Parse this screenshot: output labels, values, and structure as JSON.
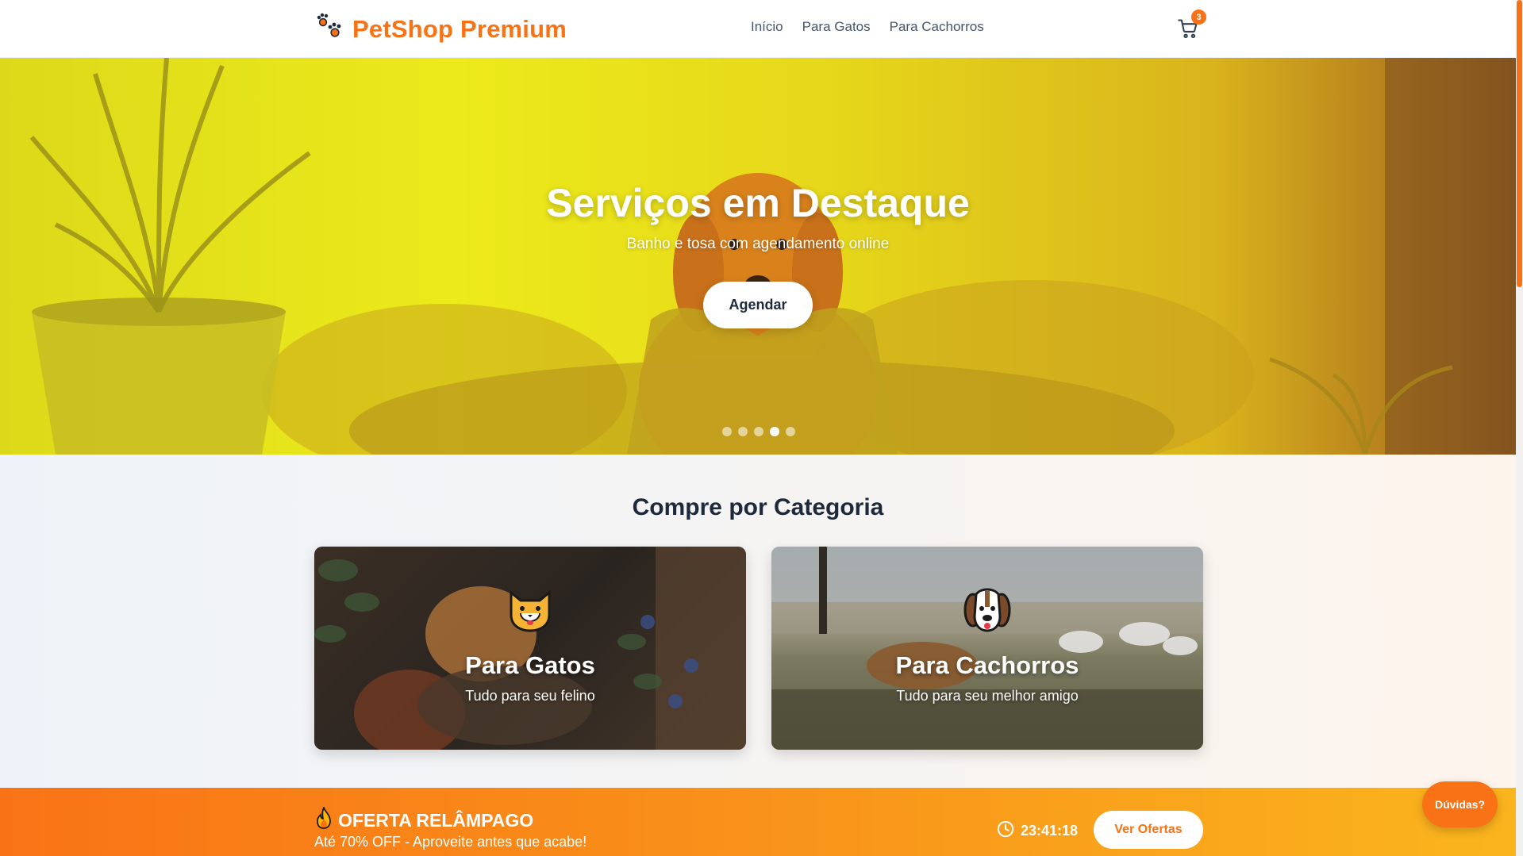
{
  "header": {
    "logo_icon": "paw-prints-icon",
    "brand": "PetShop Premium",
    "nav": [
      {
        "label": "Início"
      },
      {
        "label": "Para Gatos"
      },
      {
        "label": "Para Cachorros"
      }
    ],
    "cart_icon": "cart-icon",
    "cart_count": "3"
  },
  "hero": {
    "title": "Serviços em Destaque",
    "subtitle": "Banho e tosa com agendamento online",
    "button": "Agendar",
    "slides": 5,
    "active_slide": 4
  },
  "categories": {
    "title": "Compre por Categoria",
    "items": [
      {
        "icon": "cat-face-icon",
        "title": "Para Gatos",
        "subtitle": "Tudo para seu felino"
      },
      {
        "icon": "dog-face-icon",
        "title": "Para Cachorros",
        "subtitle": "Tudo para seu melhor amigo"
      }
    ]
  },
  "flash": {
    "icon": "fire-icon",
    "title": "OFERTA RELÂMPAGO",
    "subtitle": "Até 70% OFF - Aproveite antes que acabe!",
    "timer_icon": "clock-icon",
    "timer": "23:41:18",
    "button": "Ver Ofertas"
  },
  "help": {
    "label": "Dúvidas?"
  },
  "colors": {
    "accent": "#f97316",
    "text": "#1e293b"
  }
}
